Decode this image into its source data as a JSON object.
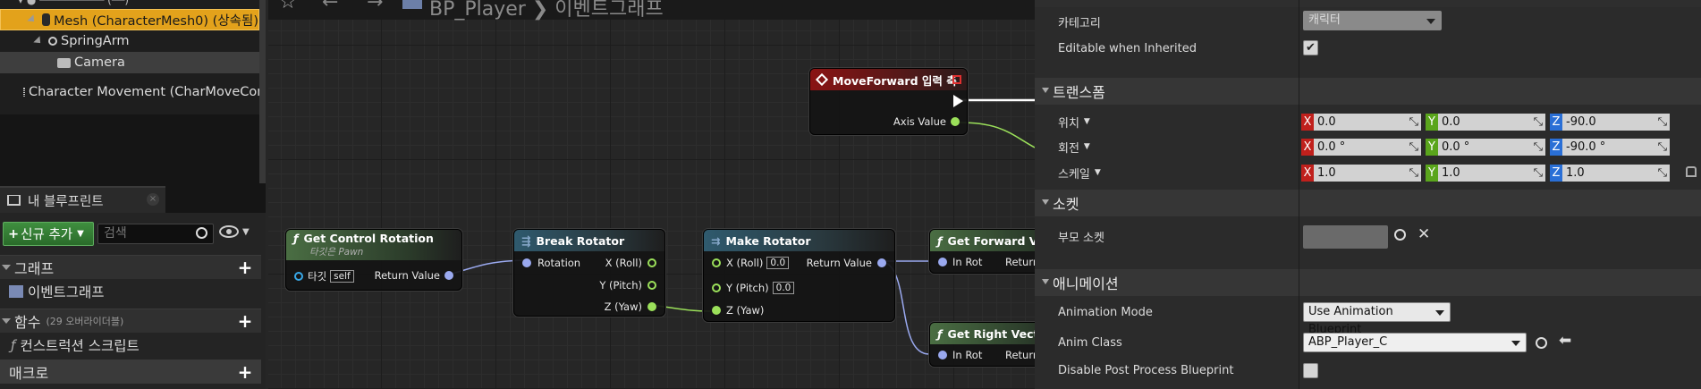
{
  "component_tree": {
    "items": [
      {
        "label": "Mesh (CharacterMesh0) (상속됨)"
      },
      {
        "label": "SpringArm"
      },
      {
        "label": "Camera"
      },
      {
        "label": "Character Movement (CharMoveComp)"
      }
    ]
  },
  "my_blueprint": {
    "tab_label": "내 블루프린트",
    "add_new_label": "신규 추가",
    "search_placeholder": "검색",
    "sections": {
      "graph": "그래프",
      "functions": "함수",
      "functions_count": "(29 오버라이더블)",
      "macros": "매크로"
    },
    "event_graph_label": "이벤트그래프",
    "construction_script_label": "컨스트럭션 스크립트"
  },
  "graph": {
    "breadcrumb": "BP_Player  ❯  이벤트그래프",
    "nodes": {
      "move_forward": {
        "title": "MoveForward 입력 축",
        "axis_value": "Axis Value"
      },
      "get_control_rotation": {
        "title": "Get Control Rotation",
        "subtitle": "타깃은 Pawn",
        "target": "타깃",
        "self": "self",
        "return_value": "Return Value"
      },
      "break_rotator": {
        "title": "Break Rotator",
        "rotation": "Rotation",
        "x": "X (Roll)",
        "y": "Y (Pitch)",
        "z": "Z (Yaw)"
      },
      "make_rotator": {
        "title": "Make Rotator",
        "x": "X (Roll)",
        "x_val": "0.0",
        "y": "Y (Pitch)",
        "y_val": "0.0",
        "z": "Z (Yaw)",
        "return_value": "Return Value"
      },
      "get_forward_vector": {
        "title": "Get Forward Vector",
        "in_rot": "In Rot",
        "return_value": "Return Value"
      },
      "get_right_vector": {
        "title": "Get Right Vector",
        "in_rot": "In Rot",
        "return_value": "Return Value"
      }
    }
  },
  "details": {
    "category_label": "카테고리",
    "category_value": "캐릭터",
    "editable_label": "Editable when Inherited",
    "editable_checked": true,
    "transform_section": "트랜스폼",
    "location_label": "위치",
    "location": {
      "x": "0.0",
      "y": "0.0",
      "z": "-90.0"
    },
    "rotation_label": "회전",
    "rotation": {
      "x": "0.0 °",
      "y": "0.0 °",
      "z": "-90.0 °"
    },
    "scale_label": "스케일",
    "scale": {
      "x": "1.0",
      "y": "1.0",
      "z": "1.0"
    },
    "socket_section": "소켓",
    "parent_socket_label": "부모 소켓",
    "animation_section": "애니메이션",
    "animation_mode_label": "Animation Mode",
    "animation_mode_value": "Use Animation Blueprint",
    "anim_class_label": "Anim Class",
    "anim_class_value": "ABP_Player_C",
    "disable_post_process_label": "Disable Post Process Blueprint",
    "disable_post_process_checked": false
  },
  "colors": {
    "selection": "#e3a21b",
    "exec_pin": "#ffffff",
    "struct_pin": "#9aa9ef",
    "float_pin": "#9be05a",
    "x_axis": "#c0201c",
    "y_axis": "#5aa51c",
    "z_axis": "#2a6fd6"
  }
}
